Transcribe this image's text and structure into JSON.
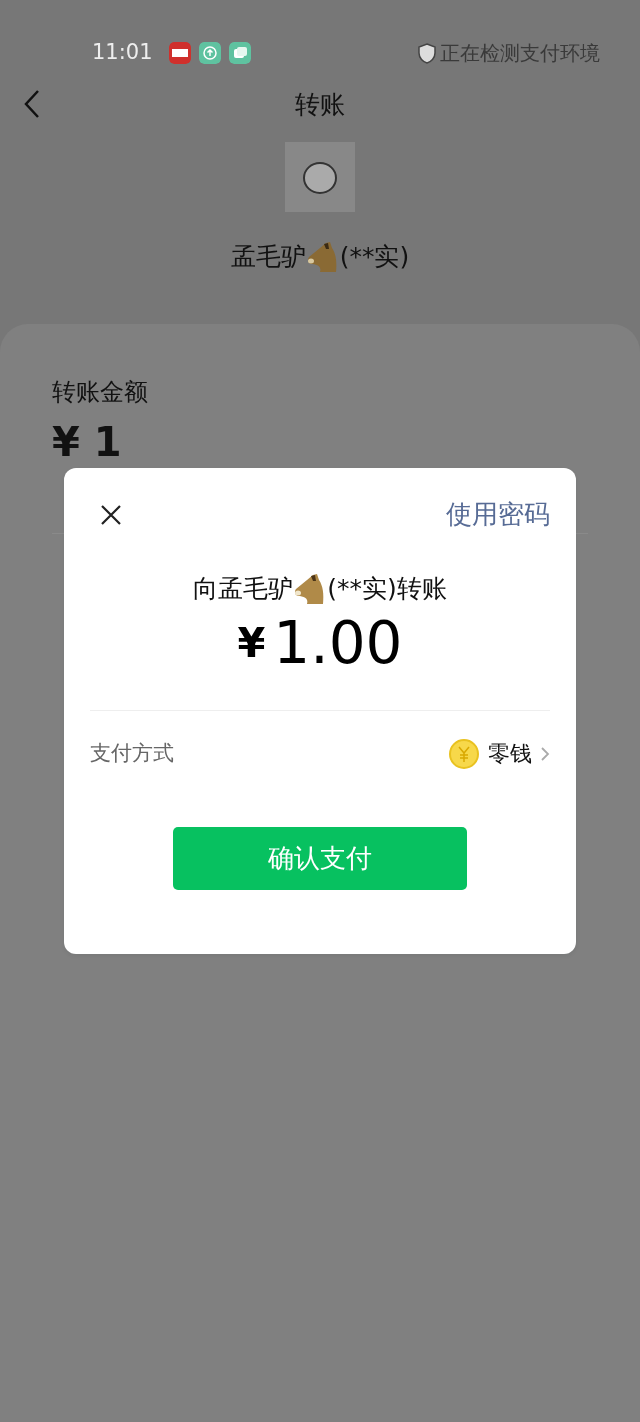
{
  "status_bar": {
    "time": "11:01",
    "notice": "正在检测支付环境"
  },
  "header": {
    "title": "转账"
  },
  "recipient": {
    "name": "孟毛驴",
    "masked_name": "(**实)"
  },
  "amount_section": {
    "label": "转账金额",
    "amount": "¥ 1"
  },
  "dialog": {
    "link": "使用密码",
    "title_before": "向孟毛驴",
    "title_after": "(**实)转账",
    "currency": "¥",
    "amount": "1.00",
    "payment": {
      "label": "支付方式",
      "method": "零钱"
    },
    "button": "确认支付"
  }
}
